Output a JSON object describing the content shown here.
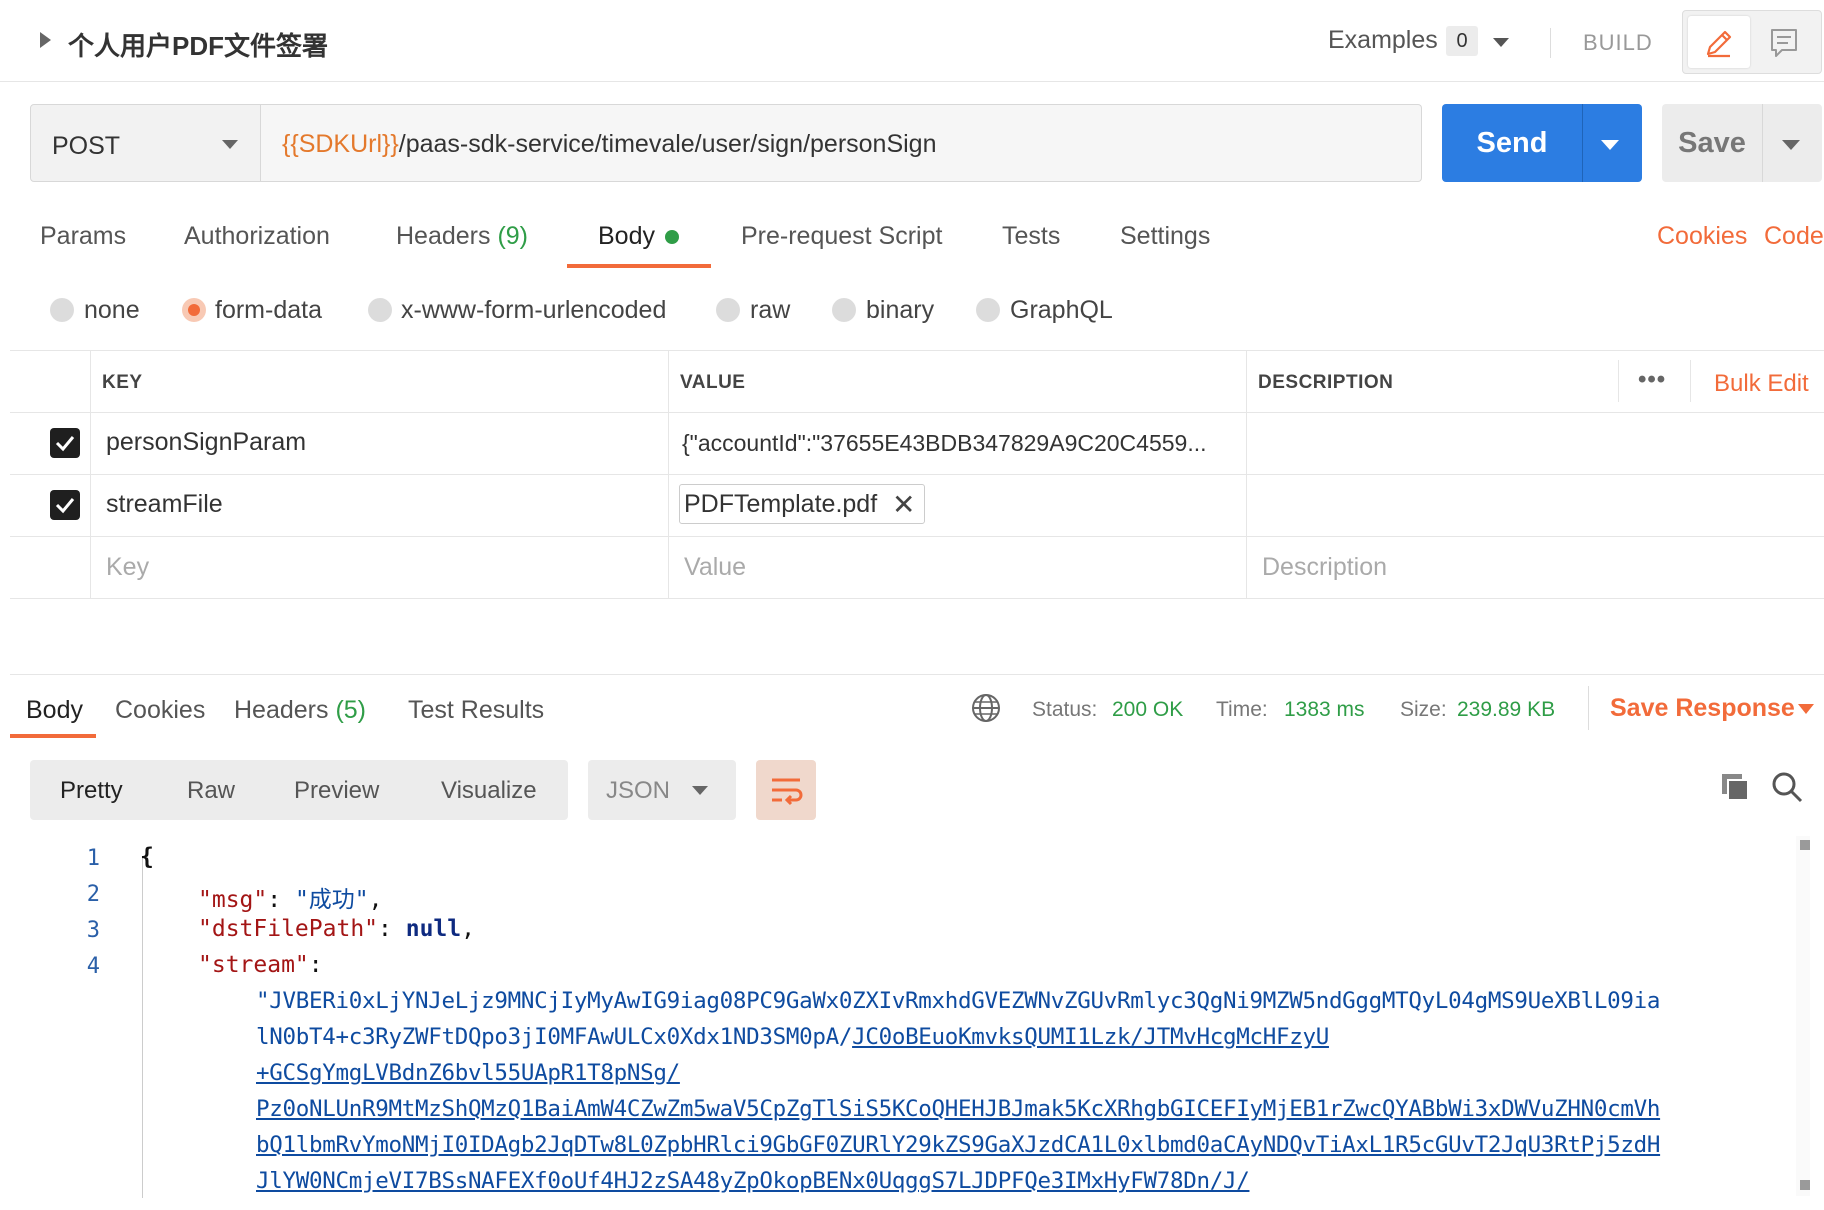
{
  "header": {
    "title": "个人用户PDF文件签署",
    "examples_label": "Examples",
    "examples_count": "0",
    "build_label": "BUILD"
  },
  "request": {
    "method": "POST",
    "url_variable": "{{SDKUrl}}",
    "url_path": "/paas-sdk-service/timevale/user/sign/personSign",
    "send_label": "Send",
    "save_label": "Save"
  },
  "tabs": {
    "params": "Params",
    "authorization": "Authorization",
    "headers": "Headers",
    "headers_count": "(9)",
    "body": "Body",
    "prerequest": "Pre-request Script",
    "tests": "Tests",
    "settings": "Settings",
    "cookies": "Cookies",
    "code": "Code"
  },
  "body_types": {
    "none": "none",
    "form_data": "form-data",
    "urlencoded": "x-www-form-urlencoded",
    "raw": "raw",
    "binary": "binary",
    "graphql": "GraphQL",
    "selected": "form-data"
  },
  "form_table": {
    "headers": {
      "key": "KEY",
      "value": "VALUE",
      "description": "DESCRIPTION"
    },
    "bulk_edit": "Bulk Edit",
    "rows": [
      {
        "key": "personSignParam",
        "value": "{\"accountId\":\"37655E43BDB347829A9C20C4559...",
        "checked": true
      },
      {
        "key": "streamFile",
        "value": "PDFTemplate.pdf",
        "checked": true
      }
    ],
    "placeholders": {
      "key": "Key",
      "value": "Value",
      "description": "Description"
    }
  },
  "response": {
    "tabs": {
      "body": "Body",
      "cookies": "Cookies",
      "headers": "Headers",
      "headers_count": "(5)",
      "test_results": "Test Results"
    },
    "status_label": "Status:",
    "status_value": "200 OK",
    "time_label": "Time:",
    "time_value": "1383 ms",
    "size_label": "Size:",
    "size_value": "239.89 KB",
    "save_response": "Save Response",
    "views": {
      "pretty": "Pretty",
      "raw": "Raw",
      "preview": "Preview",
      "visualize": "Visualize"
    },
    "format": "JSON",
    "code": {
      "line_numbers": [
        "1",
        "2",
        "3",
        "4"
      ],
      "open_brace": "{",
      "msg_key": "\"msg\"",
      "msg_val": "\"成功\"",
      "dst_key": "\"dstFilePath\"",
      "dst_val": "null",
      "stream_key": "\"stream\"",
      "stream_lines": [
        "\"JVBERi0xLjYNJeLjz9MNCjIyMyAwIG9iag08PC9GaWx0ZXIvRmxhdGVEZWNvZGUvRmlyc3QgNi9MZW5ndGggMTQyL04gMS9UeXBlL09ia",
        "lN0bT4+c3RyZWFtDQpo3jI0MFAwULCx0Xdx1ND3SM0pA/",
        "JC0oBEuoKmvksQUMI1Lzk/JTMvHcgMcHFzyU",
        "+GCSgYmgLVBdnZ6bvl55UApR1T8pNSg/",
        "Pz0oNLUnR9MtMzShQMzQ1BaiAmW4CZwZm5waV5CpZgTlSiS5KCoQHEHJBJmak5KcXRhgbGICEFIyMjEB1rZwcQYABbWi3xDWVuZHN0cmVh",
        "bQ1lbmRvYmoNMjI0IDAgb2JqDTw8L0ZpbHRlci9GbGF0ZURlY29kZS9GaXJzdCA1L0xlbmd0aCAyNDQvTiAxL1R5cGUvT2JqU3RtPj5zdH",
        "JlYW0NCmjeVI7BSsNAFEXf0oUf4HJ2zSA48yZpOkopBENx0UqggS7LJDPFQe3IMxHyFW78Dn/J/"
      ]
    }
  }
}
